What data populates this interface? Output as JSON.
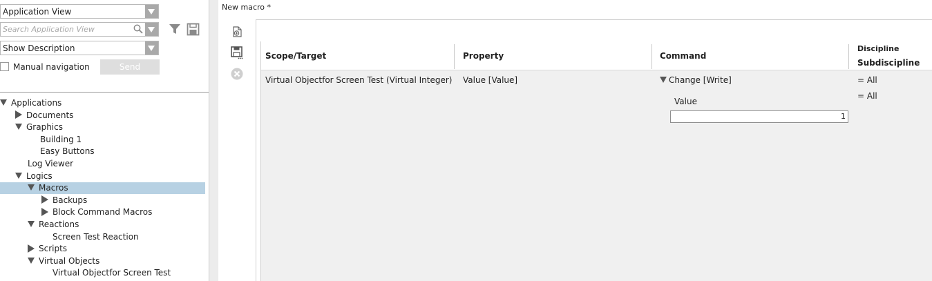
{
  "left_panel": {
    "view_combo": {
      "value": "Application View"
    },
    "search": {
      "placeholder": "Search Application View"
    },
    "description_combo": {
      "value": "Show Description"
    },
    "manual_navigation_label": "Manual navigation",
    "send_label": "Send"
  },
  "tree": {
    "items": [
      {
        "label": "Applications",
        "expander": "down"
      },
      {
        "label": "Documents",
        "expander": "right"
      },
      {
        "label": "Graphics",
        "expander": "down"
      },
      {
        "label": "Building 1",
        "expander": "none"
      },
      {
        "label": "Easy Buttons",
        "expander": "none"
      },
      {
        "label": "Log Viewer",
        "expander": "none"
      },
      {
        "label": "Logics",
        "expander": "down"
      },
      {
        "label": "Macros",
        "expander": "down",
        "selected": true
      },
      {
        "label": "Backups",
        "expander": "right"
      },
      {
        "label": "Block Command Macros",
        "expander": "right"
      },
      {
        "label": "Reactions",
        "expander": "down"
      },
      {
        "label": "Screen Test Reaction",
        "expander": "none"
      },
      {
        "label": "Scripts",
        "expander": "right"
      },
      {
        "label": "Virtual Objects",
        "expander": "down"
      },
      {
        "label": "Virtual Objectfor Screen Test",
        "expander": "none"
      }
    ]
  },
  "editor": {
    "title": "New macro *",
    "toolbar": [
      "add-step-icon",
      "save-icon",
      "delete-icon"
    ],
    "columns": {
      "scope": "Scope/Target",
      "property": "Property",
      "command": "Command",
      "discipline": "Discipline",
      "subdiscipline": "Subdiscipline"
    },
    "row": {
      "scope": "Virtual Objectfor Screen Test (Virtual Integer)",
      "property": "Value [Value]",
      "command": "Change [Write]",
      "param_label": "Value",
      "param_value": "1",
      "discipline": "=  All",
      "subdiscipline": "=  All"
    }
  },
  "colors": {
    "selection": "#b7d1e3",
    "grid_background": "#f0f0f0",
    "combo_arrow": "#a9a9a9"
  }
}
